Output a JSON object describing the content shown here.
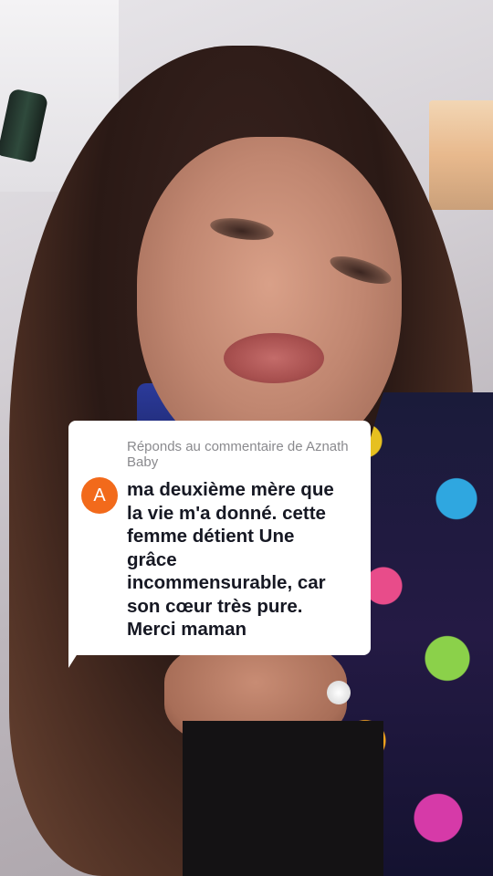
{
  "reply": {
    "header": "Réponds au commentaire de Aznath Baby",
    "avatar_initial": "A",
    "comment": "ma deuxième mère que\nla vie m'a donné. cette\nfemme détient Une\ngrâce\nincommensurable, car\nson cœur très pure.\nMerci maman"
  },
  "colors": {
    "avatar_bg": "#f26a1b",
    "card_bg": "#ffffff",
    "header_text": "#8a8a8e",
    "comment_text": "#161823"
  }
}
